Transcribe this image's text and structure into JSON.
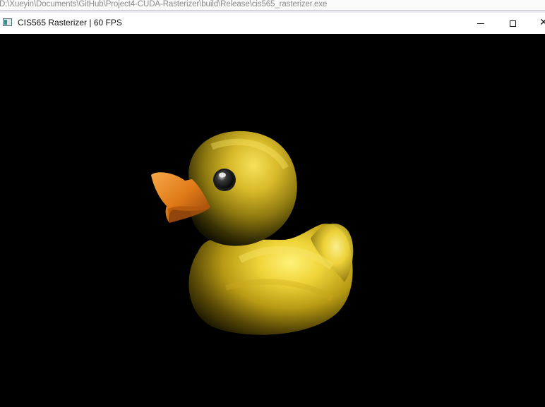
{
  "console_path": {
    "text": "D:\\Xueyin\\Documents\\GitHub\\Project4-CUDA-Rasterizer\\build\\Release\\cis565_rasterizer.exe"
  },
  "window": {
    "title": "CIS565 Rasterizer | 60 FPS",
    "icon": "application-icon",
    "controls": {
      "minimize": "minimize-icon",
      "maximize": "maximize-icon",
      "close_glyph": "✕"
    }
  },
  "viewport": {
    "background": "#000000",
    "object": "rubber-duck",
    "colors": {
      "duck_highlight": "#f6e25a",
      "duck_body": "#c8ad1c",
      "duck_shadow": "#3a3205",
      "beak": "#e8841e",
      "eye": "#1a1a1a"
    }
  }
}
